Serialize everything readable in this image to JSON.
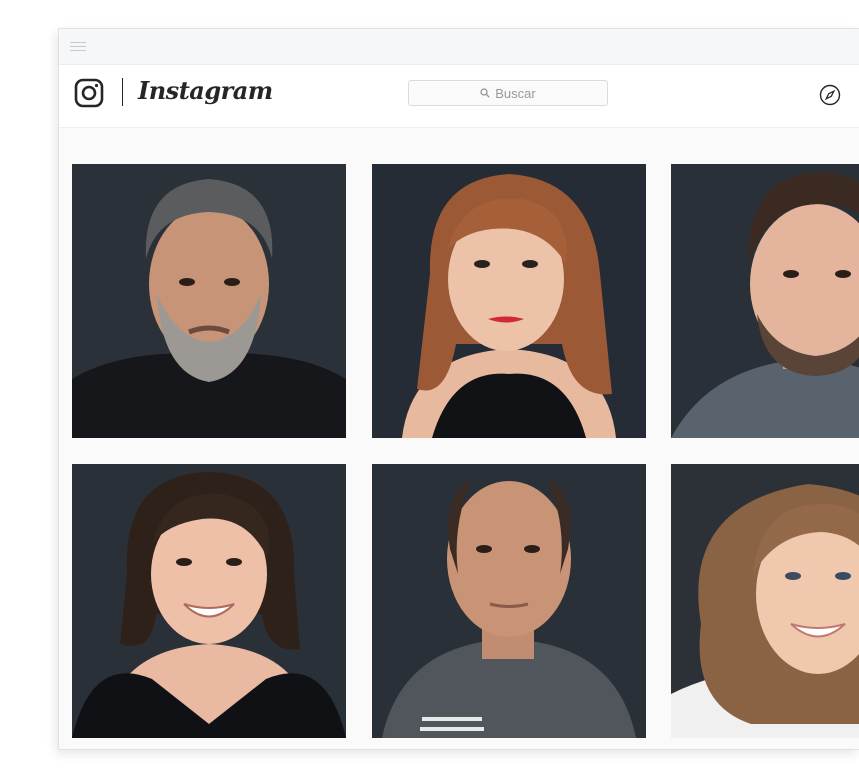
{
  "app": {
    "brand_name": "Instagram"
  },
  "search": {
    "placeholder": "Buscar"
  },
  "icons": {
    "menu": "hamburger-icon",
    "logo": "instagram-camera-icon",
    "search": "search-icon",
    "explore": "compass-icon"
  },
  "feed": {
    "posts": [
      {
        "row": 1,
        "col": 1,
        "subject": "man-gray-hair-beard"
      },
      {
        "row": 1,
        "col": 2,
        "subject": "woman-auburn-bob"
      },
      {
        "row": 1,
        "col": 3,
        "subject": "young-man-beard"
      },
      {
        "row": 2,
        "col": 1,
        "subject": "woman-dark-bob-smiling"
      },
      {
        "row": 2,
        "col": 2,
        "subject": "man-balding"
      },
      {
        "row": 2,
        "col": 3,
        "subject": "woman-wavy-hair-smiling"
      }
    ]
  },
  "colors": {
    "text": "#262626",
    "photo_backdrop": "#2a2f36",
    "border": "#dbdbdb"
  }
}
